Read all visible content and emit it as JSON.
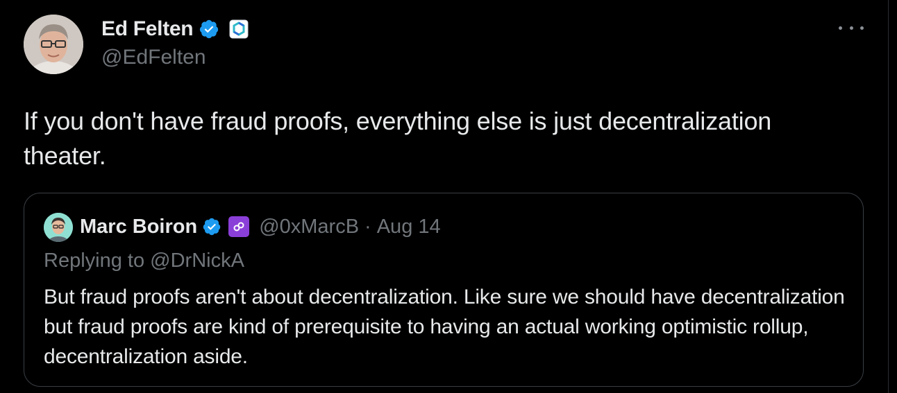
{
  "tweet": {
    "author": {
      "name": "Ed Felten",
      "handle": "@EdFelten",
      "avatar_icon": "person-photo",
      "verified_color": "#1d9bf0"
    },
    "text": "If you don't have fraud proofs, everything else is just decentralization theater.",
    "more_icon": "more-horizontal-icon"
  },
  "quoted_tweet": {
    "author": {
      "name": "Marc Boiron",
      "handle": "@0xMarcB",
      "avatar_icon": "person-avatar",
      "affiliate_color": "#8b3fd9"
    },
    "separator": "·",
    "date": "Aug 14",
    "replying_prefix": "Replying to",
    "replying_to": "@DrNickA",
    "text": "But fraud proofs aren't about decentralization. Like sure we should have decentralization but fraud proofs are kind of prerequisite to having an actual working optimistic rollup, decentralization aside."
  },
  "colors": {
    "background": "#000000",
    "text": "#e7e9ea",
    "secondary": "#71767b",
    "border": "#3a3f44",
    "verified": "#1d9bf0"
  }
}
